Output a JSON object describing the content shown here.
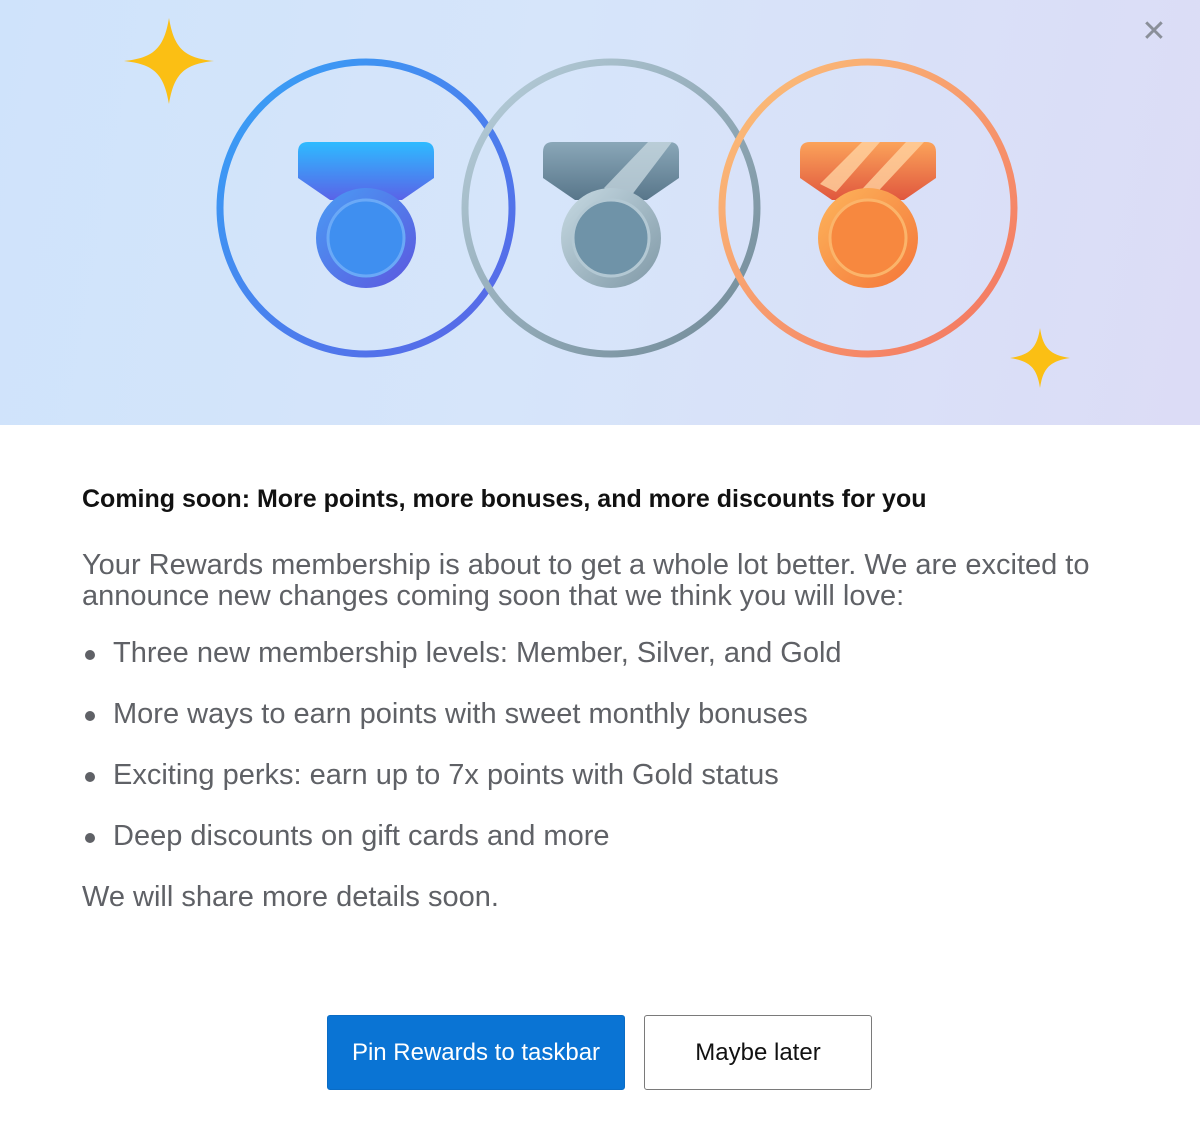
{
  "dialog": {
    "close_glyph": "✕",
    "hero": {
      "icons": [
        "sparkle-icon",
        "member-medal-icon",
        "silver-medal-icon",
        "gold-medal-icon",
        "sparkle-icon"
      ]
    },
    "title": "Coming soon: More points, more bonuses, and more discounts for you",
    "intro": "Your Rewards membership is about to get a whole lot better. We are excited to announce new changes coming soon that we think you will love:",
    "bullets": [
      "Three new membership levels: Member, Silver, and Gold",
      "More ways to earn points with sweet monthly bonuses",
      "Exciting perks: earn up to 7x points with Gold status",
      "Deep discounts on gift cards and more"
    ],
    "outro": "We will share more details soon.",
    "buttons": {
      "primary_label": "Pin Rewards to taskbar",
      "secondary_label": "Maybe later"
    }
  },
  "colors": {
    "primary_button": "#0a74d4",
    "body_text": "#5f6166",
    "title_text": "#111111",
    "sparkle": "#fbbf14",
    "member_ring": "#3b82f6",
    "silver_ring": "#8aa4b4",
    "gold_ring": "#f59f5a"
  }
}
